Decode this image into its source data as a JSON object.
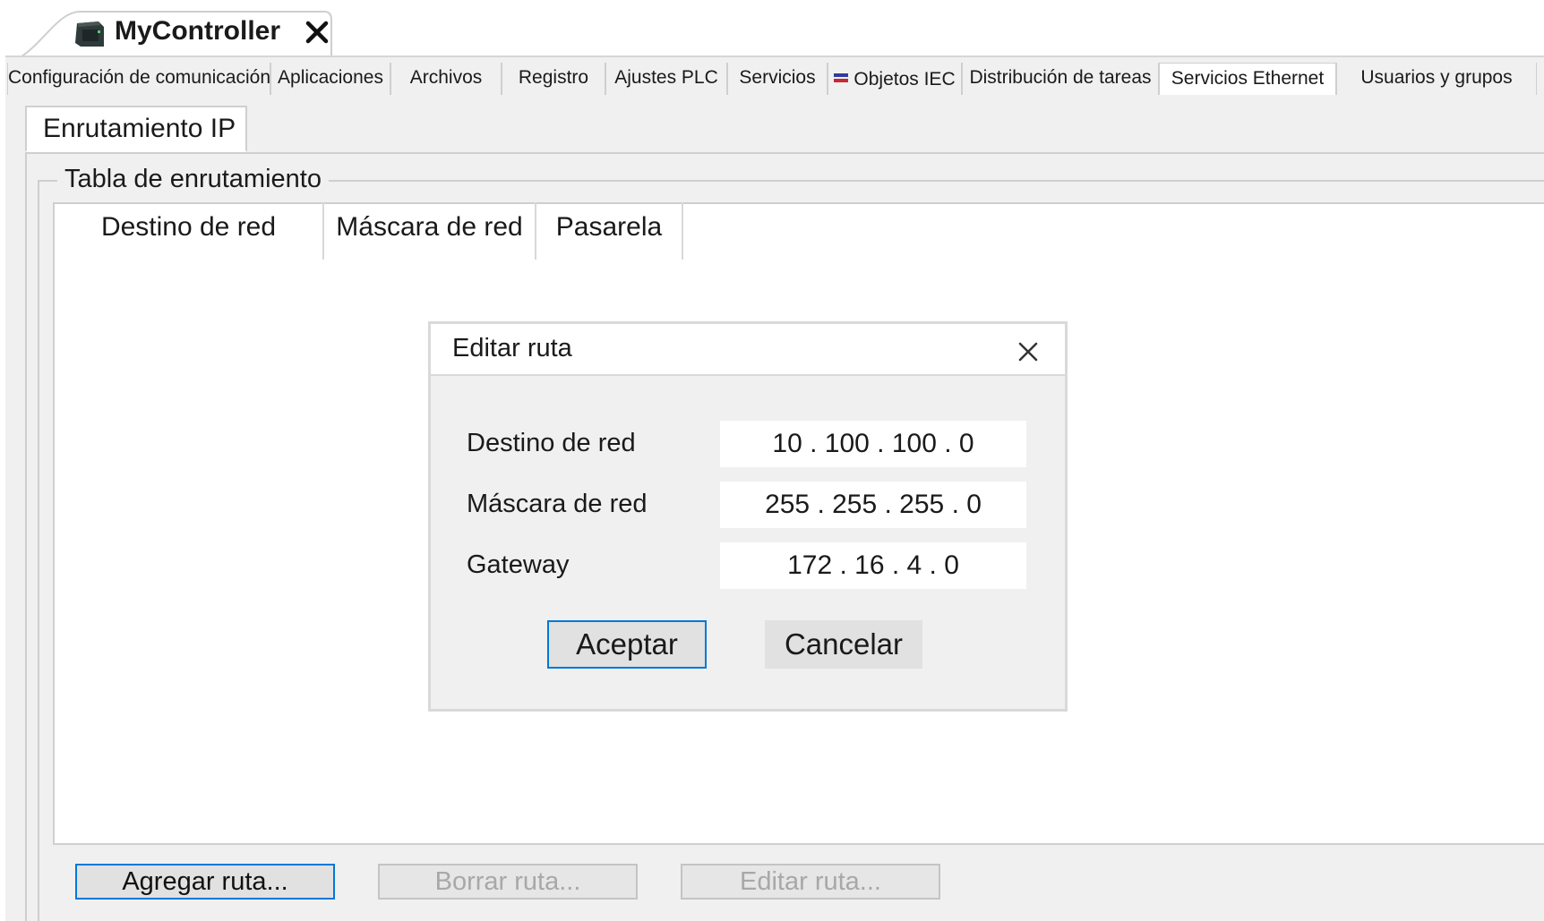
{
  "document_tab": {
    "title": "MyController"
  },
  "editor_tabs": [
    "Configuración de comunicación",
    "Aplicaciones",
    "Archivos",
    "Registro",
    "Ajustes PLC",
    "Servicios",
    "Objetos IEC",
    "Distribución de tareas",
    "Servicios Ethernet",
    "Usuarios y grupos"
  ],
  "active_editor_tab": "Servicios Ethernet",
  "sub_tab": {
    "label": "Enrutamiento IP"
  },
  "routing_table": {
    "group_title": "Tabla de enrutamiento",
    "columns": [
      "Destino de red",
      "Máscara de red",
      "Pasarela"
    ]
  },
  "bottom_buttons": {
    "add": "Agregar ruta...",
    "delete": "Borrar ruta...",
    "edit": "Editar ruta..."
  },
  "dialog": {
    "title": "Editar ruta",
    "fields": [
      {
        "label": "Destino de red",
        "value": "10 . 100 . 100 . 0"
      },
      {
        "label": "Máscara de red",
        "value": "255 . 255 . 255 . 0"
      },
      {
        "label": "Gateway",
        "value": "172 . 16 . 4 . 0"
      }
    ],
    "accept": "Aceptar",
    "cancel": "Cancelar"
  },
  "colors": {
    "panel": "#f0f0f0",
    "focus_border": "#0078d7",
    "iec_icon": [
      "#2f3c9e",
      "#c8283a"
    ]
  }
}
